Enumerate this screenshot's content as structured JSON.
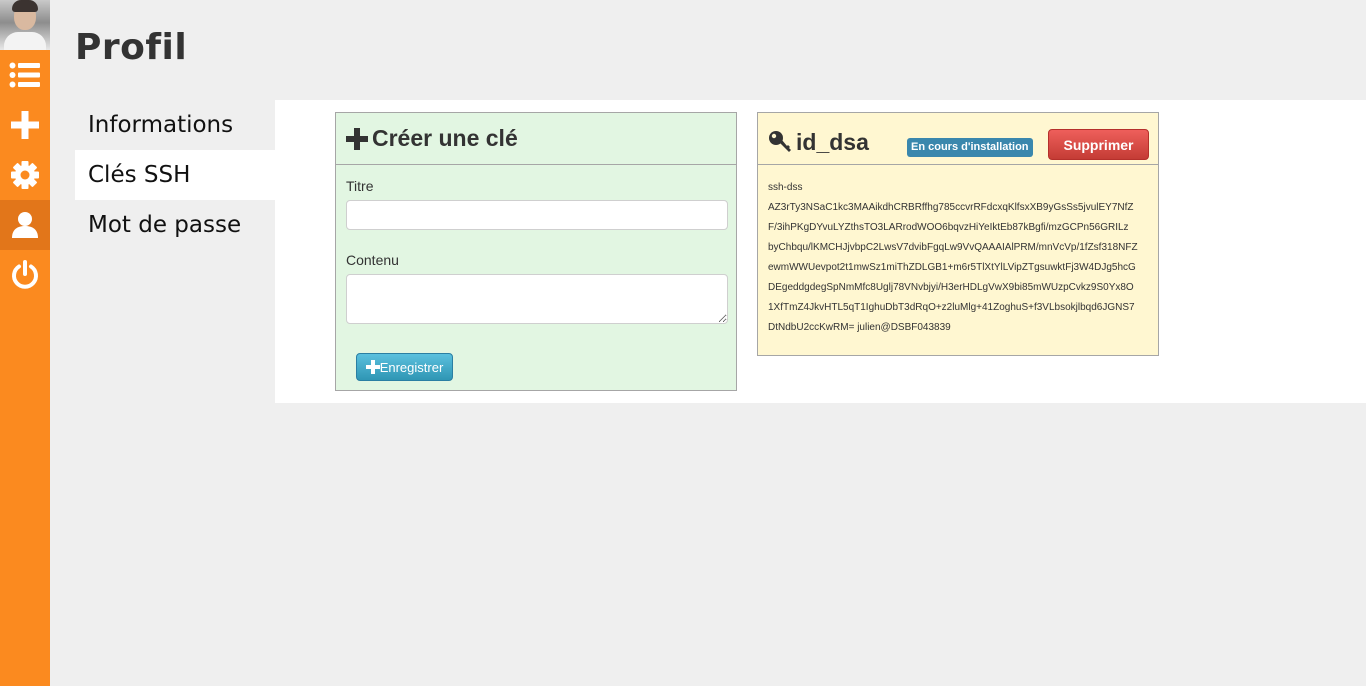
{
  "page": {
    "title": "Profil"
  },
  "sidebar": {
    "items": [
      {
        "icon": "list-icon"
      },
      {
        "icon": "plus-icon"
      },
      {
        "icon": "gear-icon"
      },
      {
        "icon": "user-icon",
        "active": true
      },
      {
        "icon": "power-icon"
      }
    ],
    "accent": "#fb8a1f"
  },
  "submenu": {
    "items": [
      {
        "label": "Informations"
      },
      {
        "label": "Clés SSH",
        "active": true
      },
      {
        "label": "Mot de passe"
      }
    ]
  },
  "create_panel": {
    "title": "Créer une clé",
    "title_label": "Titre",
    "title_value": "",
    "content_label": "Contenu",
    "content_value": "",
    "save_label": "Enregistrer",
    "background": "#e2f6e2"
  },
  "key_panel": {
    "name": "id_dsa",
    "status": "En cours d'installation",
    "delete_label": "Supprimer",
    "background": "#fff7d1",
    "key_lines": [
      "ssh-dss",
      "AZ3rTy3NSaC1kc3MAAikdhCRBRffhg785ccvrRFdcxqKlfsxXB9yGsSs5jvulEY7NfZ",
      "F/3ihPKgDYvuLYZthsTO3LARrodWOO6bqvzHiYeIktEb87kBgfi/mzGCPn56GRILz",
      "byChbqu/lKMCHJjvbpC2LwsV7dvibFgqLw9VvQAAAIAlPRM/mnVcVp/1fZsf318NFZ",
      "ewmWWUevpot2t1mwSz1miThZDLGB1+m6r5TlXtYlLVipZTgsuwktFj3W4DJg5hcG",
      "DEgeddgdegSpNmMfc8Uglj78VNvbjyi/H3erHDLgVwX9bi85mWUzpCvkz9S0Yx8O",
      "1XfTmZ4JkvHTL5qT1IghuDbT3dRqO+z2luMlg+41ZoghuS+f3VLbsokjlbqd6JGNS7",
      "DtNdbU2ccKwRM= julien@DSBF043839"
    ]
  }
}
